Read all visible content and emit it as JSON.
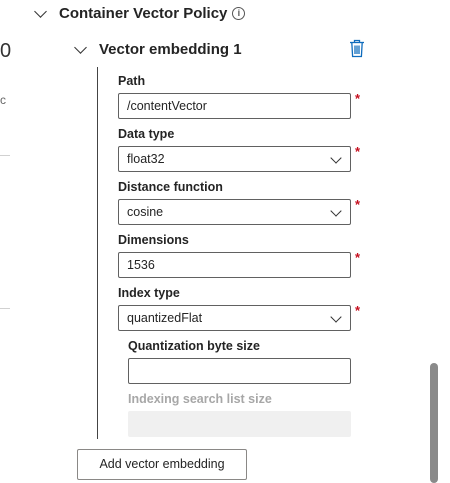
{
  "section": {
    "title": "Container Vector Policy",
    "info_icon": "info-icon"
  },
  "embedding": {
    "title": "Vector embedding 1",
    "delete_icon": "trash-icon"
  },
  "fields": {
    "path": {
      "label": "Path",
      "value": "/contentVector",
      "required": "*"
    },
    "data_type": {
      "label": "Data type",
      "value": "float32",
      "required": "*"
    },
    "distance_function": {
      "label": "Distance function",
      "value": "cosine",
      "required": "*"
    },
    "dimensions": {
      "label": "Dimensions",
      "value": "1536",
      "required": "*"
    },
    "index_type": {
      "label": "Index type",
      "value": "quantizedFlat",
      "required": "*"
    },
    "quantization_byte_size": {
      "label": "Quantization byte size",
      "value": ""
    },
    "indexing_search_list_size": {
      "label": "Indexing search list size",
      "value": ""
    }
  },
  "buttons": {
    "add_vector_embedding": "Add vector embedding"
  },
  "colors": {
    "required": "#c50f1f",
    "accent": "#0f6cbd",
    "border": "#616161"
  }
}
